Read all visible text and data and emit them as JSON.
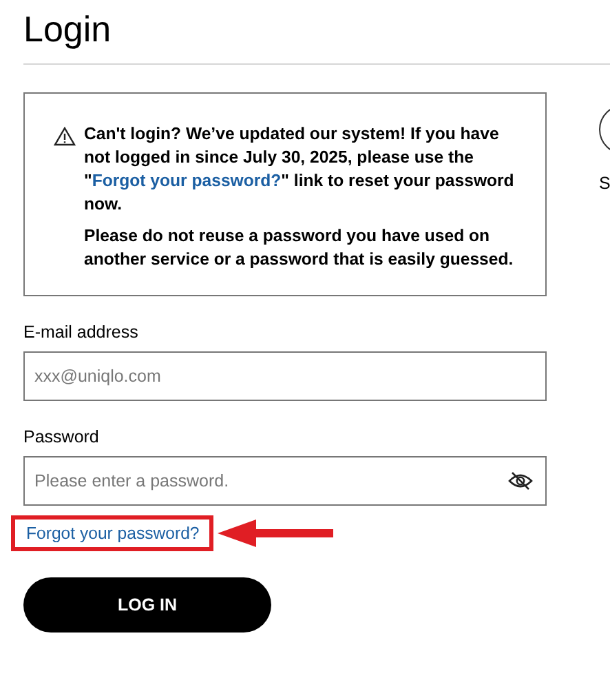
{
  "title": "Login",
  "notice": {
    "text_before": "Can't login? We’ve updated our system! If you have not logged in since July 30, 2025, please use the \"",
    "link": "Forgot your password?",
    "text_after": "\" link to reset your password now.",
    "warning": "Please do not reuse a password you have used on another service or a password that is easily guessed."
  },
  "email": {
    "label": "E-mail address",
    "placeholder": "xxx@uniqlo.com"
  },
  "password": {
    "label": "Password",
    "placeholder": "Please enter a password."
  },
  "forgot_link": {
    "label": "Forgot your password?",
    "highlighted": true
  },
  "login_button": "LOG IN",
  "side": {
    "label": "S"
  }
}
